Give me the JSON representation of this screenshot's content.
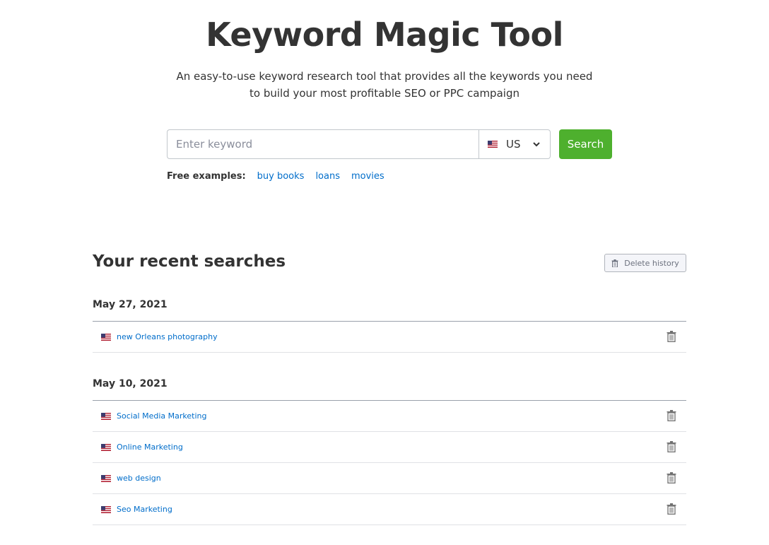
{
  "hero": {
    "title": "Keyword Magic Tool",
    "subtitle_line1": "An easy-to-use keyword research tool that provides all the keywords you need",
    "subtitle_line2": "to build your most profitable SEO or PPC campaign"
  },
  "search": {
    "placeholder": "Enter keyword",
    "value": "",
    "database": "US",
    "database_icon": "us-flag-icon",
    "button_label": "Search",
    "button_color": "#4eb02e"
  },
  "examples": {
    "label": "Free examples:",
    "items": [
      "buy books",
      "loans",
      "movies"
    ]
  },
  "recent": {
    "title": "Your recent searches",
    "delete_label": "Delete history",
    "groups": [
      {
        "date": "May 27, 2021",
        "items": [
          {
            "keyword": "new Orleans photography",
            "database": "US"
          }
        ]
      },
      {
        "date": "May 10, 2021",
        "items": [
          {
            "keyword": "Social Media Marketing",
            "database": "US"
          },
          {
            "keyword": "Online Marketing",
            "database": "US"
          },
          {
            "keyword": "web design",
            "database": "US"
          },
          {
            "keyword": "Seo Marketing",
            "database": "US"
          }
        ]
      }
    ]
  },
  "colors": {
    "link": "#006dca",
    "text": "#333333",
    "accent": "#4eb02e"
  }
}
